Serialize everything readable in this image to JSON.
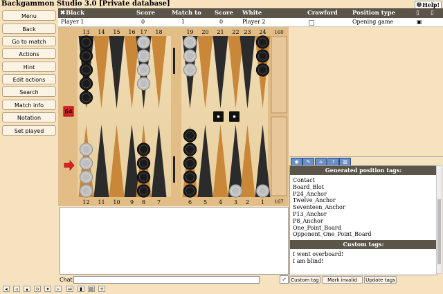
{
  "app": {
    "title": "Backgammon Studio 3.0 [Private database]",
    "help": "Help!"
  },
  "sidebar": {
    "buttons": [
      "Menu",
      "Back",
      "Go to match",
      "Actions",
      "Hint",
      "Edit actions",
      "Search",
      "Match info",
      "Notation",
      "Set played"
    ]
  },
  "match_table": {
    "headers": {
      "black": "Black",
      "score1": "Score",
      "match_to": "Match to",
      "score2": "Score",
      "white": "White",
      "crawford": "Crawford",
      "position_type": "Position type"
    },
    "row": {
      "black": "Player 1",
      "score1": "0",
      "match_to": "1",
      "score2": "0",
      "white": "Player 2",
      "position_type": "Opening game"
    }
  },
  "board": {
    "top_labels": [
      "13",
      "14",
      "15",
      "16",
      "17",
      "18",
      "19",
      "20",
      "21",
      "22",
      "23",
      "24"
    ],
    "bottom_labels": [
      "12",
      "11",
      "10",
      "9",
      "8",
      "7",
      "6",
      "5",
      "4",
      "3",
      "2",
      "1"
    ],
    "pip_top": "160",
    "pip_bottom": "167",
    "cube": "64",
    "dice": [
      1,
      1
    ]
  },
  "tags_panel": {
    "generated_header": "Generated position tags:",
    "generated_tags": [
      "Contact",
      "Board_Blot",
      "P24_Anchor",
      "Twelve_Anchor",
      "Seventeen_Anchor",
      "P13_Anchor",
      "P8_Anchor",
      "One_Point_Board",
      "Opponent_One_Point_Board"
    ],
    "custom_header": "Custom tags:",
    "custom_tags": [
      "I went overboard!",
      "I am blind!"
    ],
    "buttons": {
      "custom_tag": "Custom tag",
      "mark_invalid": "Mark invalid start",
      "update_tags": "Update tags"
    },
    "tab_icons": [
      "eye-icon",
      "edit-icon",
      "tags-icon",
      "help-icon",
      "chart-icon"
    ]
  },
  "chat": {
    "label": "Chat:",
    "value": ""
  },
  "colors": {
    "header_bg": "#5a5449",
    "panel_bg": "#f7e2c0",
    "cube_red": "#e02020",
    "tab_blue": "#6b8fc6"
  }
}
